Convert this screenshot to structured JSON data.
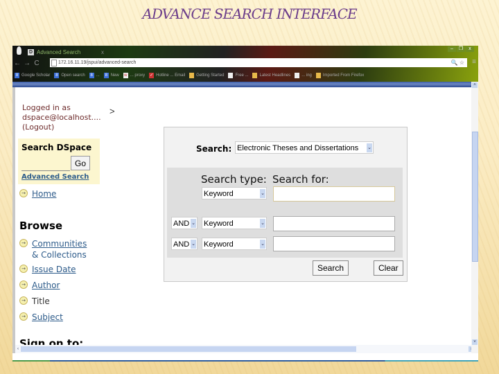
{
  "slide": {
    "title": "ADVANCE SEARCH INTERFACE"
  },
  "browser": {
    "tab": {
      "favicon": "D",
      "title": "Advanced Search",
      "close": "x"
    },
    "nav": {
      "back": "←",
      "forward": "→",
      "reload": "C"
    },
    "address": {
      "url": "172.16.11.19/jspui/advanced-search"
    },
    "bookmarks": [
      {
        "icon": "g",
        "label": "Google Scholar"
      },
      {
        "icon": "g",
        "label": "Open search"
      },
      {
        "icon": "g",
        "label": "..."
      },
      {
        "icon": "g",
        "label": "New"
      },
      {
        "icon": "w",
        "label": "... proxy"
      },
      {
        "icon": "r",
        "label": "Hotline ... Email"
      },
      {
        "icon": "f",
        "label": "Getting Started"
      },
      {
        "icon": "p",
        "label": "Free ..."
      },
      {
        "icon": "f",
        "label": "Latest Headlines"
      },
      {
        "icon": "p",
        "label": "... ing"
      },
      {
        "icon": "f",
        "label": "Imported From Firefox"
      }
    ],
    "window_buttons": [
      "–",
      "❐",
      "x"
    ]
  },
  "sidebar": {
    "login": [
      "Logged in as",
      "dspace@localhost....",
      "(Logout)"
    ],
    "breadcrumb": ">",
    "search": {
      "heading": "Search DSpace",
      "go": "Go",
      "advanced": "Advanced Search"
    },
    "home": "Home",
    "browse_heading": "Browse",
    "browse": [
      {
        "label": "Communities",
        "label2": "& Collections",
        "link": true
      },
      {
        "label": "Issue Date",
        "link": true
      },
      {
        "label": "Author",
        "link": true
      },
      {
        "label": "Title",
        "link": false
      },
      {
        "label": "Subject",
        "link": true
      }
    ],
    "signon": "Sign on to:"
  },
  "advanced_search": {
    "search_label": "Search:",
    "scope": "Electronic Theses and Dissertations",
    "search_type_header": "Search type:",
    "search_for_header": "Search for:",
    "rows": [
      {
        "conjunction": "",
        "type": "Keyword",
        "query": ""
      },
      {
        "conjunction": "AND",
        "type": "Keyword",
        "query": ""
      },
      {
        "conjunction": "AND",
        "type": "Keyword",
        "query": ""
      }
    ],
    "search_button": "Search",
    "clear_button": "Clear"
  }
}
